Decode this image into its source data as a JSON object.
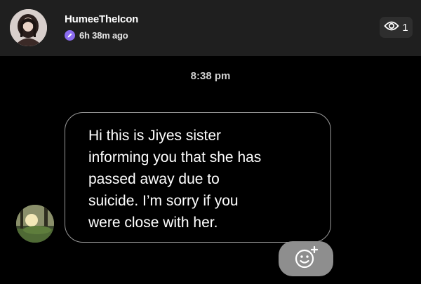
{
  "header": {
    "username": "HumeeTheIcon",
    "posted_ago": "6h 38m ago",
    "view_count": "1"
  },
  "conversation": {
    "timestamp": "8:38 pm",
    "message": "Hi this is Jiyes sister\ninforming you that she has\npassed away due to\nsuicide. I’m sorry if you\nwere close with her."
  },
  "icons": {
    "story_badge": "story-ring-icon",
    "views": "eye-icon",
    "reaction": "add-reaction-smiley-icon"
  },
  "colors": {
    "background": "#000000",
    "header": "#1f1f1f",
    "badge": "#8b6cf0",
    "bubble_border": "#9a9a9a",
    "reaction_button": "#8e8e8e"
  }
}
